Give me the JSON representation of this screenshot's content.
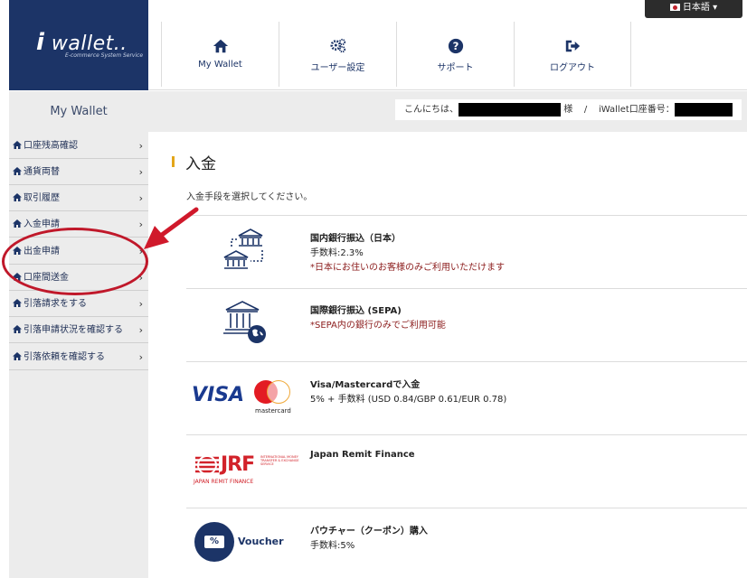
{
  "header": {
    "logo_main": "wallet",
    "logo_dots": "..",
    "logo_sub": "E-commerce System Service",
    "language": "日本語",
    "nav": [
      {
        "label": "My Wallet",
        "icon": "home-icon"
      },
      {
        "label": "ユーザー設定",
        "icon": "gears-icon"
      },
      {
        "label": "サポート",
        "icon": "question-icon"
      },
      {
        "label": "ログアウト",
        "icon": "sign-out-icon"
      }
    ]
  },
  "greeting": {
    "hello": "こんにちは、",
    "suffix": "様",
    "separator": "/",
    "account_label": "iWallet口座番号："
  },
  "sidebar": {
    "title": "My Wallet",
    "items": [
      {
        "label": "口座残高確認"
      },
      {
        "label": "通貨両替"
      },
      {
        "label": "取引履歴"
      },
      {
        "label": "入金申請"
      },
      {
        "label": "出金申請"
      },
      {
        "label": "口座間送金"
      },
      {
        "label": "引落請求をする"
      },
      {
        "label": "引落申請状況を確認する"
      },
      {
        "label": "引落依頼を確認する"
      }
    ]
  },
  "main": {
    "title": "入金",
    "instruction": "入金手段を選択してください。",
    "methods": [
      {
        "name": "国内銀行振込（日本）",
        "line": "手数料:2.3%",
        "note": "*日本にお住いのお客様のみご利用いただけます",
        "icon": "bank-transfer-icon"
      },
      {
        "name": "国際銀行振込 (SEPA)",
        "note": "*SEPA内の銀行のみでご利用可能",
        "icon": "bank-globe-icon"
      },
      {
        "name": "Visa/Mastercardで入金",
        "line": "5% + 手数料 (USD 0.84/GBP 0.61/EUR 0.78)",
        "icon": "visa-mastercard-logo",
        "logo_visa": "VISA",
        "logo_mc": "mastercard"
      },
      {
        "name": "Japan Remit Finance",
        "icon": "jrf-logo",
        "logo_jrf": "JRF",
        "logo_jrf_sub": "JAPAN REMIT FINANCE",
        "logo_jrf_tag": "INTERNATIONAL MONEY TRANSFER & EXCHANGE SERVICE"
      },
      {
        "name": "バウチャー（クーポン）購入",
        "line": "手数料:5%",
        "icon": "voucher-logo",
        "logo_voucher": "Voucher",
        "logo_pct": "%"
      }
    ]
  },
  "colors": {
    "navy": "#1c3467",
    "annotation_red": "#c0182a",
    "note_red": "#8b1b1b",
    "accent": "#e3a61a"
  }
}
